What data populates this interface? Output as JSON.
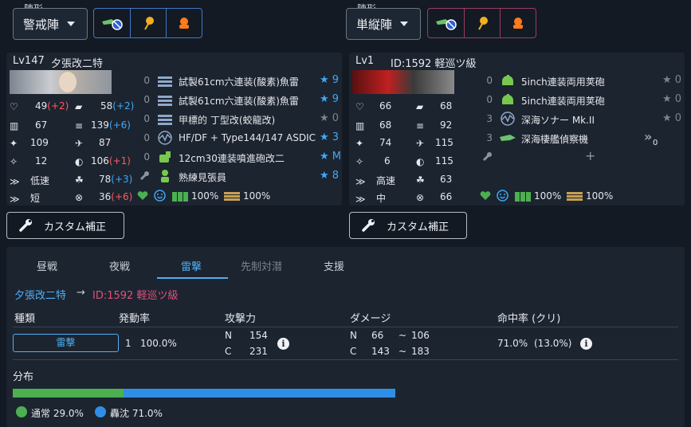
{
  "left_fleet": {
    "formation_label": "陣形",
    "formation": "警戒陣",
    "buttons": [
      "fighter-power-icon",
      "balloon-icon",
      "flagship-protect-icon"
    ]
  },
  "right_fleet": {
    "formation_label": "陣形",
    "formation": "単縦陣",
    "buttons": [
      "fighter-power-icon",
      "balloon-icon",
      "flagship-protect-icon"
    ]
  },
  "left_ship": {
    "level": "Lv147",
    "name": "夕張改二特",
    "stats": {
      "hp": "49",
      "hp_mod": "(+2)",
      "armor": "58",
      "armor_mod": "(+2)",
      "evasion": "67",
      "asw": "139",
      "asw_mod": "(+6)",
      "firepower": "109",
      "aa": "87",
      "torpedo": "12",
      "los": "106",
      "los_mod": "(+1)",
      "speed": "低速",
      "luck": "78",
      "luck_mod": "(+3)",
      "range": "短",
      "accuracy": "36",
      "accuracy_mod": "(+6)"
    },
    "slots": [
      {
        "count": "0",
        "name": "試製61cm六連装(酸素)魚雷",
        "stars": "★ 9"
      },
      {
        "count": "0",
        "name": "試製61cm六連装(酸素)魚雷",
        "stars": "★ 9"
      },
      {
        "count": "0",
        "name": "甲標的 丁型改(蛟龍改)",
        "stars": "★ 0"
      },
      {
        "count": "0",
        "name": "HF/DF + Type144/147 ASDIC",
        "stars": "★ 3"
      },
      {
        "count": "0",
        "name": "12cm30連装噴進砲改二",
        "stars": "★ M"
      },
      {
        "count": "",
        "name": "熟練見張員",
        "stars": "★ 8"
      }
    ],
    "fuel": "100%",
    "ammo": "100%",
    "custom_label": "カスタム補正"
  },
  "right_ship": {
    "level": "Lv1",
    "name": "ID:1592 軽巡ツ級",
    "stats": {
      "hp": "66",
      "armor": "68",
      "evasion": "68",
      "asw": "92",
      "firepower": "74",
      "aa": "115",
      "torpedo": "6",
      "los": "115",
      "speed": "高速",
      "luck": "63",
      "range": "中",
      "accuracy": "66"
    },
    "slots": [
      {
        "count": "0",
        "name": "5inch連装両用荚砲",
        "stars": "★ 0"
      },
      {
        "count": "0",
        "name": "5inch連装両用荚砲",
        "stars": "★ 0"
      },
      {
        "count": "3",
        "name": "深海ソナー Mk.II",
        "stars": "★ 0"
      },
      {
        "count": "3",
        "name": "深海棲艦偵察機",
        "stars": "0"
      }
    ],
    "fuel": "100%",
    "ammo": "100%",
    "custom_label": "カスタム補正"
  },
  "tabs": [
    "昼戦",
    "夜戦",
    "雷撃",
    "先制対潜",
    "支援"
  ],
  "active_tab": "雷撃",
  "matchup": {
    "attacker": "夕張改二特",
    "arrow": "→",
    "defender": "ID:1592 軽巡ツ級"
  },
  "table": {
    "headers": [
      "種類",
      "発動率",
      "攻撃力",
      "ダメージ",
      "命中率 (クリ)"
    ],
    "row": {
      "type": "雷撃",
      "count": "1",
      "rate": "100.0%",
      "atk_n_label": "N",
      "atk_n": "154",
      "atk_c_label": "C",
      "atk_c": "231",
      "dmg_n_label": "N",
      "dmg_n_min": "66",
      "dmg_n_max": "106",
      "dmg_c_label": "C",
      "dmg_c_min": "143",
      "dmg_c_max": "183",
      "tilde": "~",
      "hit": "71.0%",
      "crit": "(13.0%)"
    }
  },
  "distribution": {
    "title": "分布",
    "normal_label": "通常 29.0%",
    "sink_label": "轟沈 71.0%",
    "normal_fraction": 0.29,
    "sink_fraction": 0.71,
    "colors": {
      "normal": "#4caf50",
      "sink": "#2f8fe6"
    }
  }
}
